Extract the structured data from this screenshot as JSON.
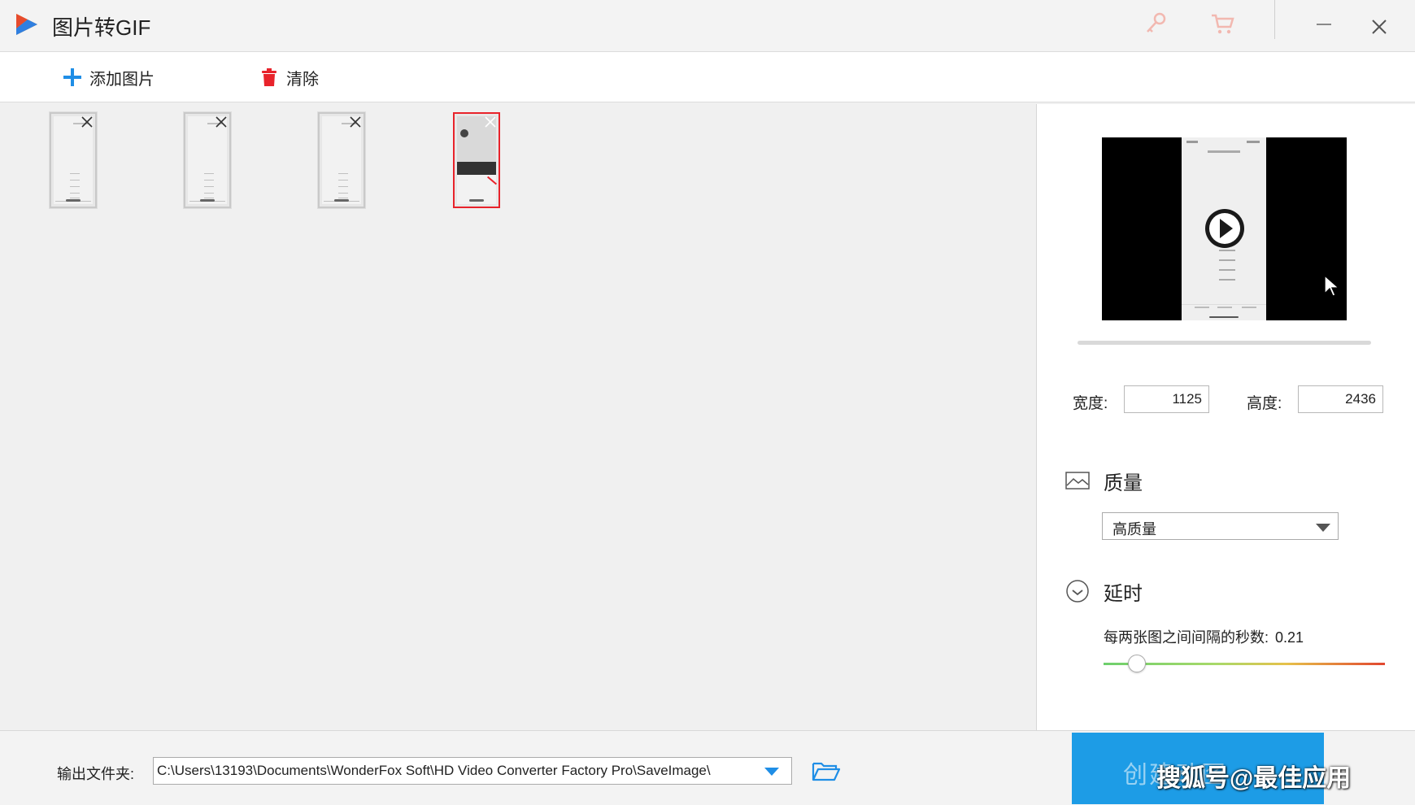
{
  "app": {
    "title": "图片转GIF"
  },
  "toolbar": {
    "add_images_label": "添加图片",
    "clear_label": "清除"
  },
  "thumbnails": [
    {
      "selected": false
    },
    {
      "selected": false
    },
    {
      "selected": false
    },
    {
      "selected": true
    }
  ],
  "settings": {
    "width_label": "宽度:",
    "width_value": "1125",
    "height_label": "高度:",
    "height_value": "2436",
    "quality_title": "质量",
    "quality_value": "高质量",
    "delay_title": "延时",
    "delay_text": "每两张图之间间隔的秒数:",
    "delay_value": "0.21",
    "delay_slider_fraction": 0.1
  },
  "output": {
    "label": "输出文件夹:",
    "path": "C:\\Users\\13193\\Documents\\WonderFox Soft\\HD Video Converter Factory Pro\\SaveImage\\"
  },
  "create_button_label": "创建动图",
  "watermark": "搜狐号@最佳应用",
  "colors": {
    "accent_blue": "#1d9ce6",
    "delete_red": "#e8232b",
    "selected_border": "#e8232b"
  },
  "icons": [
    "app-logo-icon",
    "key-icon",
    "cart-icon",
    "minimize-icon",
    "close-icon",
    "plus-icon",
    "trash-icon",
    "play-icon",
    "landscape-icon",
    "clock-icon",
    "chevron-down-icon",
    "folder-open-icon"
  ]
}
